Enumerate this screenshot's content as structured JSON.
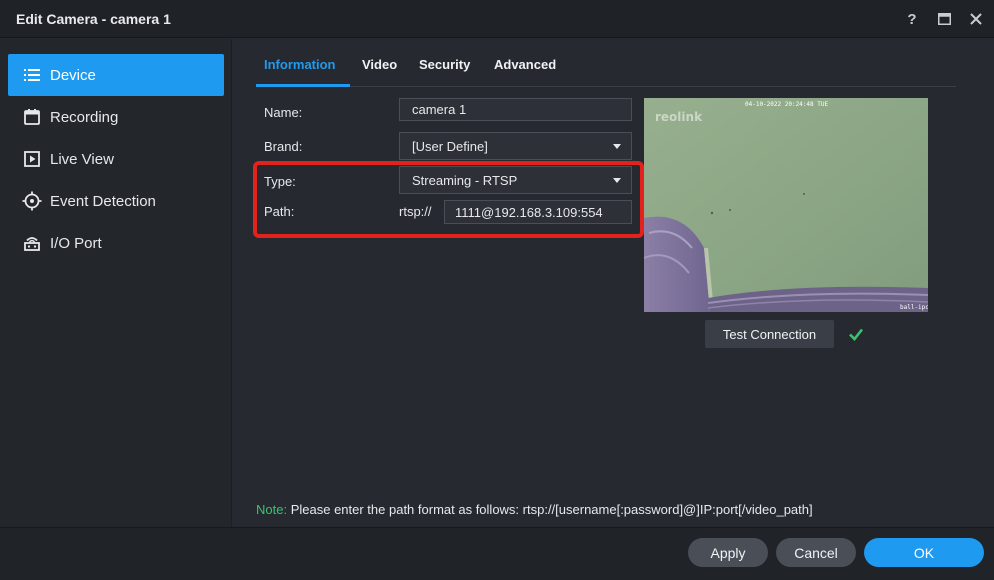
{
  "window": {
    "title": "Edit Camera - camera 1",
    "help_label": "?"
  },
  "sidebar": {
    "items": [
      {
        "label": "Device",
        "icon": "list-icon",
        "active": true
      },
      {
        "label": "Recording",
        "icon": "calendar-icon",
        "active": false
      },
      {
        "label": "Live View",
        "icon": "play-icon",
        "active": false
      },
      {
        "label": "Event Detection",
        "icon": "crosshair-icon",
        "active": false
      },
      {
        "label": "I/O Port",
        "icon": "io-port-icon",
        "active": false
      }
    ]
  },
  "tabs": [
    {
      "label": "Information",
      "active": true
    },
    {
      "label": "Video",
      "active": false
    },
    {
      "label": "Security",
      "active": false
    },
    {
      "label": "Advanced",
      "active": false
    }
  ],
  "form": {
    "name_label": "Name:",
    "name_value": "camera 1",
    "brand_label": "Brand:",
    "brand_value": "[User Define]",
    "type_label": "Type:",
    "type_value": "Streaming - RTSP",
    "path_label": "Path:",
    "path_prefix": "rtsp://",
    "path_value": "1111@192.168.3.109:554"
  },
  "preview": {
    "brand_watermark": "reolink",
    "timestamp": "04-10-2022 20:24:48 TUE",
    "camera_name": "ball-ipc"
  },
  "test_connection": {
    "label": "Test Connection",
    "status_icon": "checkmark-icon",
    "status_color": "#3ec06e"
  },
  "note": {
    "label": "Note:",
    "text": "Please enter the path format as follows: rtsp://[username[:password]@]IP:port[/video_path]"
  },
  "footer": {
    "apply_label": "Apply",
    "cancel_label": "Cancel",
    "ok_label": "OK"
  },
  "colors": {
    "accent": "#1e9bf0",
    "highlight": "#e3221e",
    "success": "#3ec06e"
  }
}
